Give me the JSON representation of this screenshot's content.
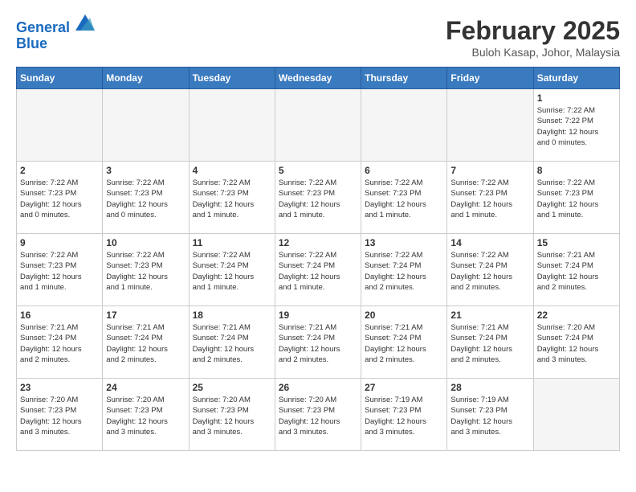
{
  "header": {
    "logo_line1": "General",
    "logo_line2": "Blue",
    "month_year": "February 2025",
    "location": "Buloh Kasap, Johor, Malaysia"
  },
  "weekdays": [
    "Sunday",
    "Monday",
    "Tuesday",
    "Wednesday",
    "Thursday",
    "Friday",
    "Saturday"
  ],
  "weeks": [
    [
      {
        "day": "",
        "info": ""
      },
      {
        "day": "",
        "info": ""
      },
      {
        "day": "",
        "info": ""
      },
      {
        "day": "",
        "info": ""
      },
      {
        "day": "",
        "info": ""
      },
      {
        "day": "",
        "info": ""
      },
      {
        "day": "1",
        "info": "Sunrise: 7:22 AM\nSunset: 7:22 PM\nDaylight: 12 hours\nand 0 minutes."
      }
    ],
    [
      {
        "day": "2",
        "info": "Sunrise: 7:22 AM\nSunset: 7:23 PM\nDaylight: 12 hours\nand 0 minutes."
      },
      {
        "day": "3",
        "info": "Sunrise: 7:22 AM\nSunset: 7:23 PM\nDaylight: 12 hours\nand 0 minutes."
      },
      {
        "day": "4",
        "info": "Sunrise: 7:22 AM\nSunset: 7:23 PM\nDaylight: 12 hours\nand 1 minute."
      },
      {
        "day": "5",
        "info": "Sunrise: 7:22 AM\nSunset: 7:23 PM\nDaylight: 12 hours\nand 1 minute."
      },
      {
        "day": "6",
        "info": "Sunrise: 7:22 AM\nSunset: 7:23 PM\nDaylight: 12 hours\nand 1 minute."
      },
      {
        "day": "7",
        "info": "Sunrise: 7:22 AM\nSunset: 7:23 PM\nDaylight: 12 hours\nand 1 minute."
      },
      {
        "day": "8",
        "info": "Sunrise: 7:22 AM\nSunset: 7:23 PM\nDaylight: 12 hours\nand 1 minute."
      }
    ],
    [
      {
        "day": "9",
        "info": "Sunrise: 7:22 AM\nSunset: 7:23 PM\nDaylight: 12 hours\nand 1 minute."
      },
      {
        "day": "10",
        "info": "Sunrise: 7:22 AM\nSunset: 7:23 PM\nDaylight: 12 hours\nand 1 minute."
      },
      {
        "day": "11",
        "info": "Sunrise: 7:22 AM\nSunset: 7:24 PM\nDaylight: 12 hours\nand 1 minute."
      },
      {
        "day": "12",
        "info": "Sunrise: 7:22 AM\nSunset: 7:24 PM\nDaylight: 12 hours\nand 1 minute."
      },
      {
        "day": "13",
        "info": "Sunrise: 7:22 AM\nSunset: 7:24 PM\nDaylight: 12 hours\nand 2 minutes."
      },
      {
        "day": "14",
        "info": "Sunrise: 7:22 AM\nSunset: 7:24 PM\nDaylight: 12 hours\nand 2 minutes."
      },
      {
        "day": "15",
        "info": "Sunrise: 7:21 AM\nSunset: 7:24 PM\nDaylight: 12 hours\nand 2 minutes."
      }
    ],
    [
      {
        "day": "16",
        "info": "Sunrise: 7:21 AM\nSunset: 7:24 PM\nDaylight: 12 hours\nand 2 minutes."
      },
      {
        "day": "17",
        "info": "Sunrise: 7:21 AM\nSunset: 7:24 PM\nDaylight: 12 hours\nand 2 minutes."
      },
      {
        "day": "18",
        "info": "Sunrise: 7:21 AM\nSunset: 7:24 PM\nDaylight: 12 hours\nand 2 minutes."
      },
      {
        "day": "19",
        "info": "Sunrise: 7:21 AM\nSunset: 7:24 PM\nDaylight: 12 hours\nand 2 minutes."
      },
      {
        "day": "20",
        "info": "Sunrise: 7:21 AM\nSunset: 7:24 PM\nDaylight: 12 hours\nand 2 minutes."
      },
      {
        "day": "21",
        "info": "Sunrise: 7:21 AM\nSunset: 7:24 PM\nDaylight: 12 hours\nand 2 minutes."
      },
      {
        "day": "22",
        "info": "Sunrise: 7:20 AM\nSunset: 7:24 PM\nDaylight: 12 hours\nand 3 minutes."
      }
    ],
    [
      {
        "day": "23",
        "info": "Sunrise: 7:20 AM\nSunset: 7:23 PM\nDaylight: 12 hours\nand 3 minutes."
      },
      {
        "day": "24",
        "info": "Sunrise: 7:20 AM\nSunset: 7:23 PM\nDaylight: 12 hours\nand 3 minutes."
      },
      {
        "day": "25",
        "info": "Sunrise: 7:20 AM\nSunset: 7:23 PM\nDaylight: 12 hours\nand 3 minutes."
      },
      {
        "day": "26",
        "info": "Sunrise: 7:20 AM\nSunset: 7:23 PM\nDaylight: 12 hours\nand 3 minutes."
      },
      {
        "day": "27",
        "info": "Sunrise: 7:19 AM\nSunset: 7:23 PM\nDaylight: 12 hours\nand 3 minutes."
      },
      {
        "day": "28",
        "info": "Sunrise: 7:19 AM\nSunset: 7:23 PM\nDaylight: 12 hours\nand 3 minutes."
      },
      {
        "day": "",
        "info": ""
      }
    ]
  ]
}
